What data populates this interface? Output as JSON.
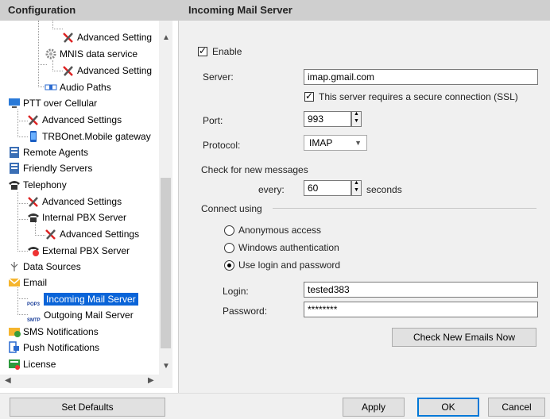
{
  "left_panel": {
    "title": "Configuration",
    "tree": [
      {
        "label": "Advanced Setting",
        "icon": "tools-icon"
      },
      {
        "label": "MNIS data service",
        "icon": "gear-icon"
      },
      {
        "label": "Advanced Setting",
        "icon": "tools-icon"
      },
      {
        "label": "Audio Paths",
        "icon": "audio-paths-icon"
      },
      {
        "label": "PTT over Cellular",
        "icon": "monitor-icon"
      },
      {
        "label": "Advanced Settings",
        "icon": "tools-icon"
      },
      {
        "label": "TRBOnet.Mobile gateway",
        "icon": "mobile-icon"
      },
      {
        "label": "Remote Agents",
        "icon": "server-icon"
      },
      {
        "label": "Friendly Servers",
        "icon": "server-icon"
      },
      {
        "label": "Telephony",
        "icon": "telephone-icon"
      },
      {
        "label": "Advanced Settings",
        "icon": "tools-icon"
      },
      {
        "label": "Internal PBX Server",
        "icon": "telephone-icon"
      },
      {
        "label": "Advanced Settings",
        "icon": "tools-icon"
      },
      {
        "label": "External PBX Server",
        "icon": "pbx-icon"
      },
      {
        "label": "Data Sources",
        "icon": "data-sources-icon"
      },
      {
        "label": "Email",
        "icon": "envelope-icon"
      },
      {
        "label": "Incoming Mail Server",
        "icon": "pop3-icon",
        "badge": "POP3"
      },
      {
        "label": "Outgoing Mail Server",
        "icon": "smtp-icon",
        "badge": "SMTP"
      },
      {
        "label": "SMS Notifications",
        "icon": "sms-icon"
      },
      {
        "label": "Push Notifications",
        "icon": "push-icon"
      },
      {
        "label": "License",
        "icon": "license-icon"
      }
    ],
    "set_defaults": "Set Defaults"
  },
  "main": {
    "title": "Incoming Mail Server",
    "enable_label": "Enable",
    "enable_checked": true,
    "server_label": "Server:",
    "server_value": "imap.gmail.com",
    "ssl_label": "This server requires a secure connection (SSL)",
    "ssl_checked": true,
    "port_label": "Port:",
    "port_value": "993",
    "protocol_label": "Protocol:",
    "protocol_value": "IMAP",
    "check_label": "Check for new messages",
    "every_label": "every:",
    "every_value": "60",
    "seconds_label": "seconds",
    "connect_label": "Connect using",
    "radio_anonymous": "Anonymous access",
    "radio_windows": "Windows authentication",
    "radio_login": "Use login and password",
    "selected_auth": "Use login and password",
    "login_label": "Login:",
    "login_value": "tested383",
    "password_label": "Password:",
    "password_value": "********",
    "check_now": "Check New Emails Now"
  },
  "footer": {
    "apply": "Apply",
    "ok": "OK",
    "cancel": "Cancel"
  },
  "colors": {
    "selection": "#0a64d8",
    "header": "#cfcfcf"
  }
}
